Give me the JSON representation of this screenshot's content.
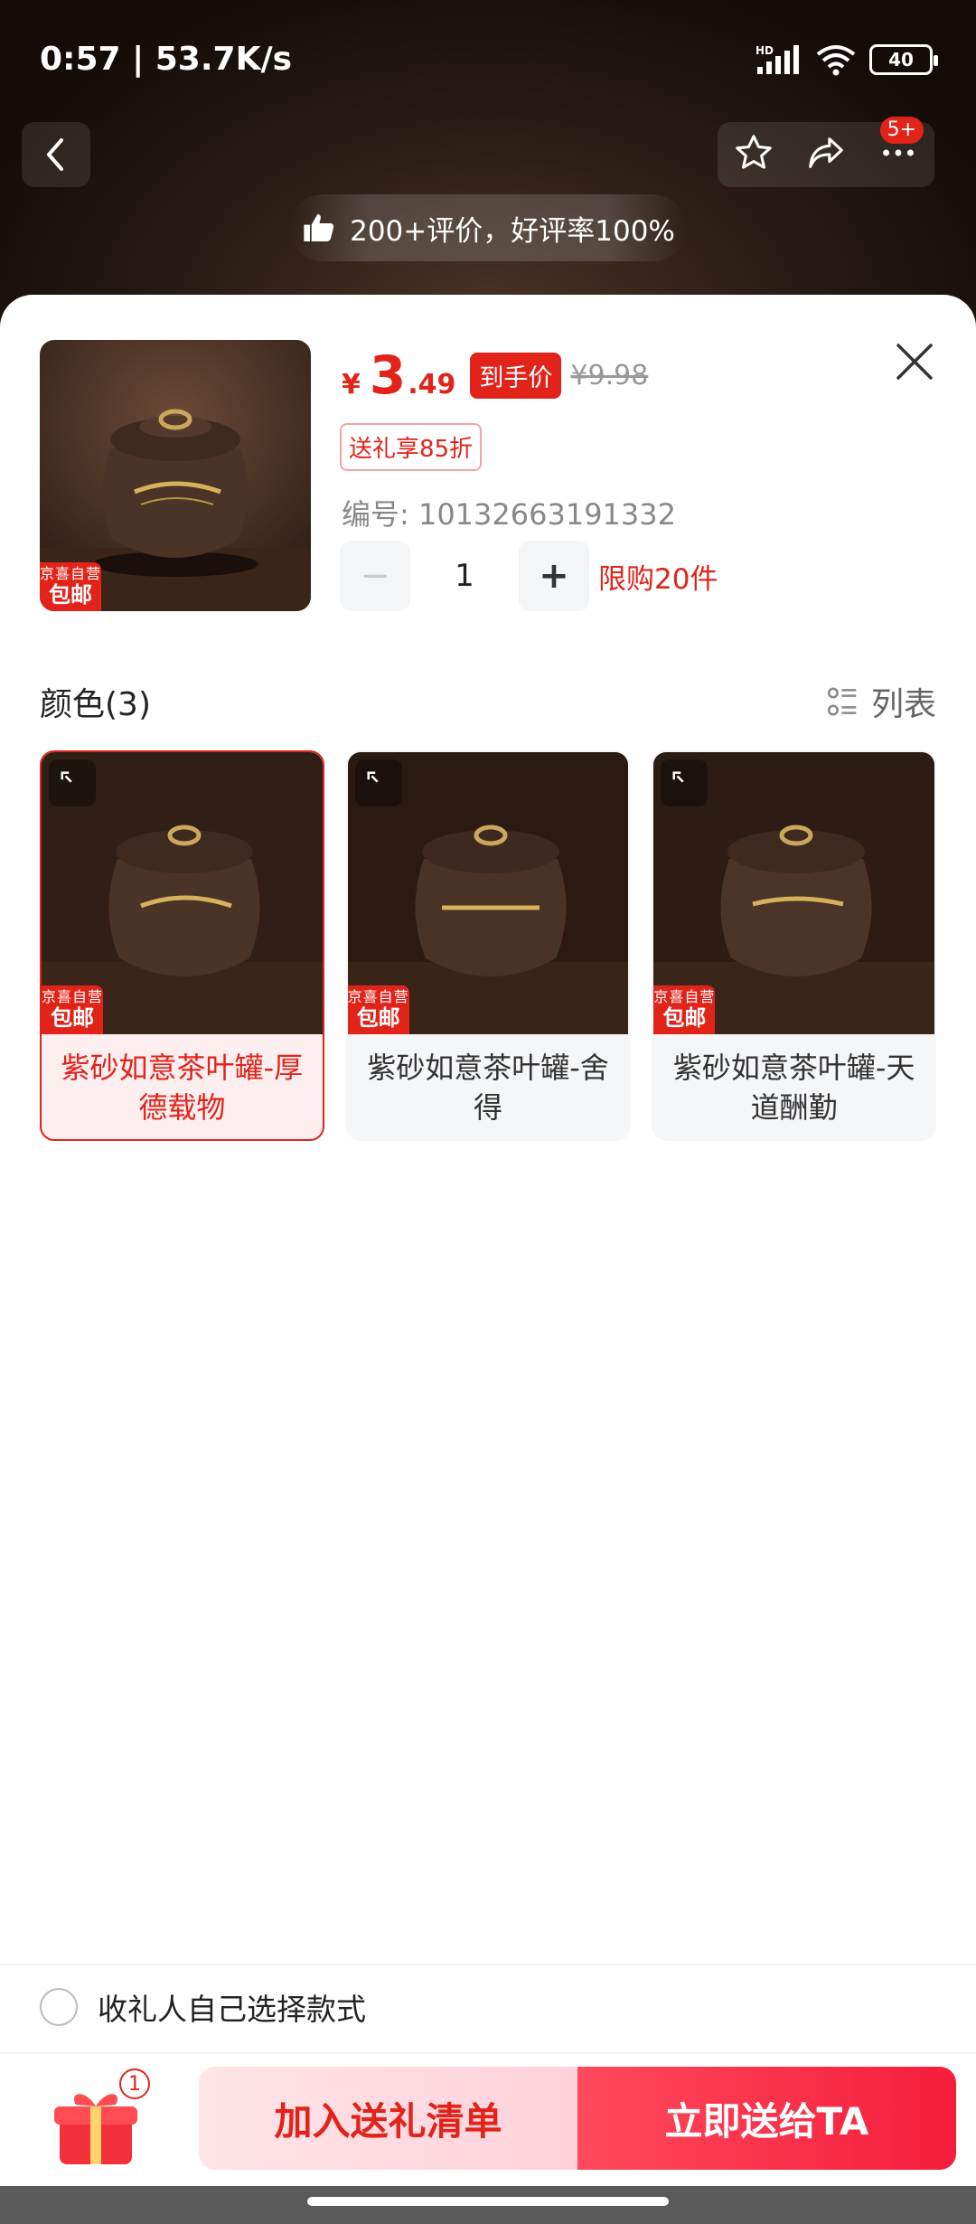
{
  "status_bar": {
    "time_speed": "0:57 | 53.7K/s",
    "battery": "40",
    "network_label": "HD"
  },
  "top_bar": {
    "notification_badge": "5+"
  },
  "review_banner": {
    "text": "200+评价，好评率100%"
  },
  "product": {
    "currency": "¥",
    "price_int": "3",
    "price_dec": ".49",
    "to_hand_label": "到手价",
    "original_price": "¥9.98",
    "gift_discount": "送礼享85折",
    "sku_label": "编号: 10132663191332",
    "quantity": "1",
    "minus_symbol": "−",
    "plus_symbol": "+",
    "limit_text": "限购20件",
    "jd_tag_line1": "京喜自营",
    "jd_tag_line2": "包邮"
  },
  "colors": {
    "title": "颜色(3)",
    "list_toggle": "列表",
    "variants": [
      {
        "label": "紫砂如意茶叶罐-厚德载物",
        "tag1": "京喜自营",
        "tag2": "包邮",
        "selected": true
      },
      {
        "label": "紫砂如意茶叶罐-舍得",
        "tag1": "京喜自营",
        "tag2": "包邮",
        "selected": false
      },
      {
        "label": "紫砂如意茶叶罐-天道酬勤",
        "tag1": "京喜自营",
        "tag2": "包邮",
        "selected": false
      }
    ]
  },
  "self_select": {
    "label": "收礼人自己选择款式"
  },
  "bottom": {
    "gift_count": "1",
    "add_button": "加入送礼清单",
    "send_button": "立即送给TA"
  },
  "colors_palette": {
    "accent": "#e2231a",
    "send_gradient_end": "#f51d3b",
    "add_bg": "#ffd2da"
  }
}
